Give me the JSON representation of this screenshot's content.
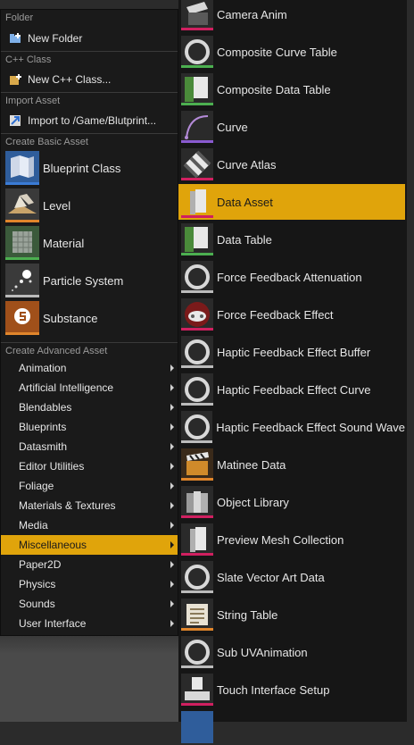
{
  "left_menu": {
    "folder_header": "Folder",
    "new_folder": "New Folder",
    "cpp_header": "C++ Class",
    "new_cpp": "New C++ Class...",
    "import_header": "Import Asset",
    "import_to": "Import to /Game/Blutprint...",
    "basic_header": "Create Basic Asset",
    "basic_items": [
      {
        "label": "Blueprint Class",
        "icon": "blueprint-class-icon"
      },
      {
        "label": "Level",
        "icon": "level-icon"
      },
      {
        "label": "Material",
        "icon": "material-icon"
      },
      {
        "label": "Particle System",
        "icon": "particle-system-icon"
      },
      {
        "label": "Substance",
        "icon": "substance-icon"
      }
    ],
    "advanced_header": "Create Advanced Asset",
    "advanced_items": [
      "Animation",
      "Artificial Intelligence",
      "Blendables",
      "Blueprints",
      "Datasmith",
      "Editor Utilities",
      "Foliage",
      "Materials & Textures",
      "Media",
      "Miscellaneous",
      "Paper2D",
      "Physics",
      "Sounds",
      "User Interface"
    ],
    "active_advanced": "Miscellaneous"
  },
  "right_menu": {
    "items": [
      "Camera Anim",
      "Composite Curve Table",
      "Composite Data Table",
      "Curve",
      "Curve Atlas",
      "Data Asset",
      "Data Table",
      "Force Feedback Attenuation",
      "Force Feedback Effect",
      "Haptic Feedback Effect Buffer",
      "Haptic Feedback Effect Curve",
      "Haptic Feedback Effect Sound Wave",
      "Matinee Data",
      "Object Library",
      "Preview Mesh Collection",
      "Slate Vector Art Data",
      "String Table",
      "Sub UVAnimation",
      "Touch Interface Setup"
    ],
    "active": "Data Asset"
  },
  "colors": {
    "highlight": "#e0a40b",
    "menu_bg": "#1a1a1a",
    "accent_orange": "#e0852b"
  }
}
